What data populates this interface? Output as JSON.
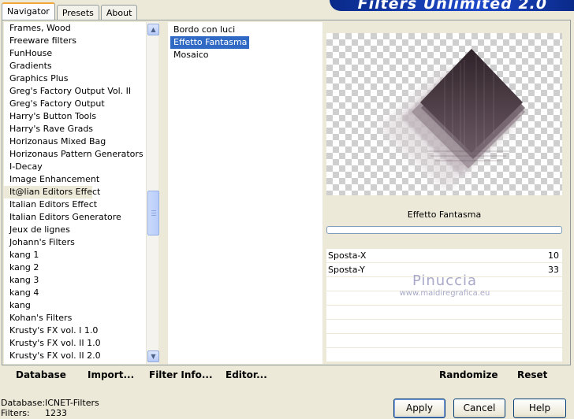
{
  "banner": {
    "title": "Filters Unlimited 2.0"
  },
  "tabs": [
    "Navigator",
    "Presets",
    "About"
  ],
  "categories": {
    "items": [
      "Frames, Wood",
      "Freeware filters",
      "FunHouse",
      "Gradients",
      "Graphics Plus",
      "Greg's Factory Output Vol. II",
      "Greg's Factory Output",
      "Harry's Button Tools",
      "Harry's Rave Grads",
      "Horizonaus Mixed Bag",
      "Horizonaus Pattern Generators",
      "I-Decay",
      "Image Enhancement",
      "It@lian Editors Effect",
      "Italian Editors Effect",
      "Italian Editors Generatore",
      "Jeux de lignes",
      "Johann's Filters",
      "kang 1",
      "kang 2",
      "kang 3",
      "kang 4",
      "kang",
      "Kohan's Filters",
      "Krusty's FX vol. I 1.0",
      "Krusty's FX vol. II 1.0",
      "Krusty's FX vol. II 2.0"
    ],
    "selected": "It@lian Editors Effect"
  },
  "filters": {
    "items": [
      "Bordo con luci",
      "Effetto Fantasma",
      "Mosaico"
    ],
    "selected": "Effetto Fantasma"
  },
  "preview": {
    "filter_title": "Effetto Fantasma",
    "params": [
      {
        "label": "Sposta-X",
        "value": "10"
      },
      {
        "label": "Sposta-Y",
        "value": "33"
      }
    ],
    "empty_rows": 6,
    "watermark_name": "Pinuccia",
    "watermark_url": "www.maidiregrafica.eu"
  },
  "actions": {
    "database": "Database",
    "import": "Import...",
    "filter_info": "Filter Info...",
    "editor": "Editor...",
    "randomize": "Randomize",
    "reset": "Reset"
  },
  "footer": {
    "database_label": "Database:",
    "database_value": "ICNET-Filters",
    "filters_label": "Filters:",
    "filters_value": "1233"
  },
  "buttons": {
    "apply": "Apply",
    "cancel": "Cancel",
    "help": "Help"
  },
  "colors": {
    "selection": "#316ac5",
    "banner": "#1d48c8",
    "background": "#ece9d8"
  }
}
